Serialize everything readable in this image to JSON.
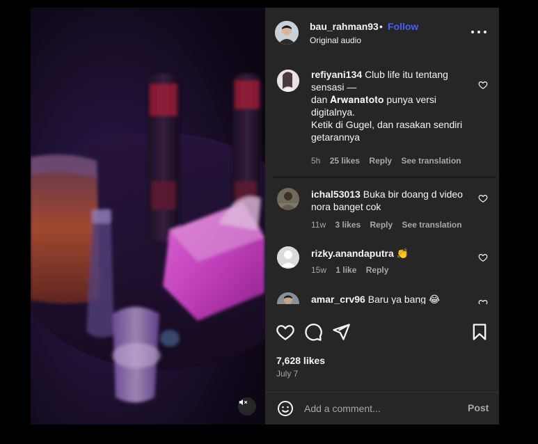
{
  "header": {
    "username": "bau_rahman93",
    "separator": "•",
    "follow_label": "Follow",
    "audio_label": "Original audio",
    "more_icon": "more-horizontal-icon"
  },
  "comments": [
    {
      "username": "refiyani134",
      "text": "Club life itu tentang sensasi — dan 𝐀𝐫𝐰𝐚𝐧𝐚𝐭𝐨𝐭𝐨 punya versi digitalnya. Ketik di Gugel, dan rasakan sendiri getarannya",
      "lines": [
        "Club life itu tentang",
        "sensasi —",
        "dan 𝐀𝐫𝐰𝐚𝐧𝐚𝐭𝐨𝐭𝐨 punya versi",
        "digitalnya.",
        "Ketik di Gugel, dan rasakan sendiri",
        "getarannya"
      ],
      "time": "5h",
      "likes": "25 likes",
      "reply": "Reply",
      "translate": "See translation"
    },
    {
      "username": "ichal53013",
      "text": "Buka bir doang d video nora banget cok",
      "lines": [
        "Buka bir doang d video",
        "nora banget cok"
      ],
      "time": "11w",
      "likes": "3 likes",
      "reply": "Reply",
      "translate": "See translation"
    },
    {
      "username": "rizky.anandaputra",
      "text": "👏",
      "time": "15w",
      "likes": "1 like",
      "reply": "Reply"
    },
    {
      "username": "amar_crv96",
      "text": "Baru ya bang 😂"
    }
  ],
  "actions": {
    "like_icon": "heart-icon",
    "comment_icon": "comment-icon",
    "share_icon": "send-icon",
    "save_icon": "bookmark-icon"
  },
  "likes_count": "7,628 likes",
  "post_date": "July 7",
  "comment_bar": {
    "placeholder": "Add a comment...",
    "post_label": "Post",
    "emoji_icon": "emoji-icon"
  },
  "media": {
    "mute_icon": "speaker-muted-icon"
  },
  "colors": {
    "panel_bg": "#262626",
    "follow_blue": "#4a5df9",
    "secondary_text": "#a8a8a8"
  }
}
